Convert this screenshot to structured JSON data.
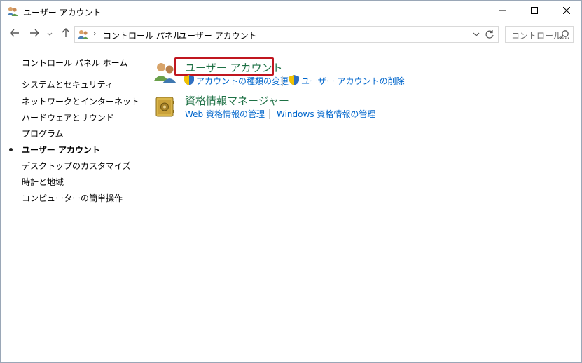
{
  "window": {
    "title": "ユーザー アカウント",
    "icon": "users-icon"
  },
  "titlebar_buttons": {
    "minimize_icon": "minimize-icon",
    "maximize_icon": "maximize-icon",
    "close_icon": "close-icon"
  },
  "nav": {
    "back_icon": "arrow-left-icon",
    "forward_icon": "arrow-right-icon",
    "recent_icon": "chevron-down-icon",
    "up_icon": "arrow-up-icon",
    "breadcrumbs": [
      "コントロール パネル",
      "ユーザー アカウント"
    ],
    "refresh_icon": "refresh-icon"
  },
  "search": {
    "placeholder": "コントロール..."
  },
  "sidebar": {
    "items": [
      {
        "label": "コントロール パネル ホーム",
        "active": false
      },
      {
        "label": "システムとセキュリティ",
        "active": false
      },
      {
        "label": "ネットワークとインターネット",
        "active": false
      },
      {
        "label": "ハードウェアとサウンド",
        "active": false
      },
      {
        "label": "プログラム",
        "active": false
      },
      {
        "label": "ユーザー アカウント",
        "active": true
      },
      {
        "label": "デスクトップのカスタマイズ",
        "active": false
      },
      {
        "label": "時計と地域",
        "active": false
      },
      {
        "label": "コンピューターの簡単操作",
        "active": false
      }
    ]
  },
  "main": {
    "user_accounts": {
      "title": "ユーザー アカウント",
      "links": [
        "アカウントの種類の変更",
        "ユーザー アカウントの削除"
      ]
    },
    "credential_manager": {
      "title": "資格情報マネージャー",
      "links": [
        "Web 資格情報の管理",
        "Windows 資格情報の管理"
      ]
    }
  },
  "colors": {
    "group_title": "#1e7145",
    "link": "#0066cc",
    "highlight_border": "#c0161f"
  }
}
